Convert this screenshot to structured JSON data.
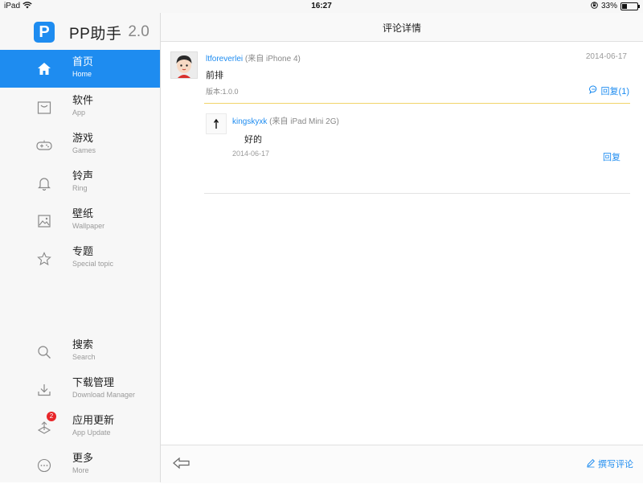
{
  "status_bar": {
    "device": "iPad",
    "time": "16:27",
    "battery": "33%",
    "battery_level": 0.33
  },
  "brand": {
    "logo_letter": "P",
    "name": "PP助手",
    "version": "2.0"
  },
  "sidebar": {
    "items": [
      {
        "label": "首页",
        "sub": "Home",
        "icon": "home-icon",
        "active": true
      },
      {
        "label": "软件",
        "sub": "App",
        "icon": "app-icon"
      },
      {
        "label": "游戏",
        "sub": "Games",
        "icon": "gamepad-icon"
      },
      {
        "label": "铃声",
        "sub": "Ring",
        "icon": "bell-icon"
      },
      {
        "label": "壁纸",
        "sub": "Wallpaper",
        "icon": "image-icon"
      },
      {
        "label": "专题",
        "sub": "Special topic",
        "icon": "star-icon"
      },
      {
        "label": "搜索",
        "sub": "Search",
        "icon": "search-icon"
      },
      {
        "label": "下载管理",
        "sub": "Download Manager",
        "icon": "download-icon"
      },
      {
        "label": "应用更新",
        "sub": "App Update",
        "icon": "update-icon",
        "badge": "2"
      },
      {
        "label": "更多",
        "sub": "More",
        "icon": "more-icon"
      }
    ]
  },
  "page": {
    "title": "评论详情"
  },
  "comment": {
    "username": "ltforeverlei",
    "source": "(来自 iPhone 4)",
    "date": "2014-06-17",
    "body": "前排",
    "version": "版本:1.0.0",
    "reply_label": "回复(1)"
  },
  "reply": {
    "username": "kingskyxk",
    "source": "(来自 iPad Mini 2G)",
    "body": "好的",
    "date": "2014-06-17",
    "reply_label": "回复"
  },
  "bottom": {
    "write_label": "撰写评论"
  },
  "colors": {
    "accent": "#1e8cf0",
    "badge": "#e8262a",
    "divider": "#f1d46a"
  }
}
